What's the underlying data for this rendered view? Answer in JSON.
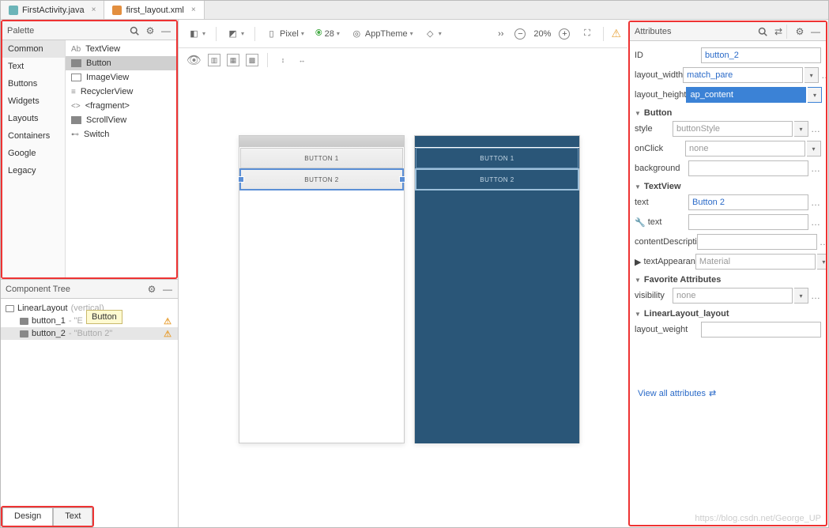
{
  "tabs": {
    "file1": "FirstActivity.java",
    "file2": "first_layout.xml"
  },
  "palette": {
    "title": "Palette",
    "cats": [
      "Common",
      "Text",
      "Buttons",
      "Widgets",
      "Layouts",
      "Containers",
      "Google",
      "Legacy"
    ],
    "items": [
      "TextView",
      "Button",
      "ImageView",
      "RecyclerView",
      "<fragment>",
      "ScrollView",
      "Switch"
    ]
  },
  "comptree": {
    "title": "Component Tree",
    "root": "LinearLayout",
    "root_suffix": "(vertical)",
    "row1_name": "button_1",
    "row1_val": "- \"E",
    "row2_name": "button_2",
    "row2_val": "- \"Button 2\"",
    "tooltip": "Button"
  },
  "bottom": {
    "design": "Design",
    "text": "Text"
  },
  "toolbar": {
    "device": "Pixel",
    "api": "28",
    "theme": "AppTheme",
    "zoom": "20%"
  },
  "preview": {
    "btn1": "BUTTON 1",
    "btn2": "BUTTON 2"
  },
  "attrs": {
    "title": "Attributes",
    "id_label": "ID",
    "id_val": "button_2",
    "lw_label": "layout_width",
    "lw_val": "match_pare",
    "lh_label": "layout_height",
    "lh_val": "ap_content",
    "sect_button": "Button",
    "style_label": "style",
    "style_val": "buttonStyle",
    "onclick_label": "onClick",
    "onclick_val": "none",
    "bg_label": "background",
    "bg_val": "",
    "sect_textview": "TextView",
    "text_label": "text",
    "text_val": "Button 2",
    "text2_label": "text",
    "text2_val": "",
    "cd_label": "contentDescripti",
    "cd_val": "",
    "ta_label": "textAppearan",
    "ta_val": "Material",
    "sect_fav": "Favorite Attributes",
    "vis_label": "visibility",
    "vis_val": "none",
    "sect_ll": "LinearLayout_layout",
    "lwe_label": "layout_weight",
    "lwe_val": "",
    "viewall": "View all attributes"
  },
  "watermark": "https://blog.csdn.net/George_UP"
}
